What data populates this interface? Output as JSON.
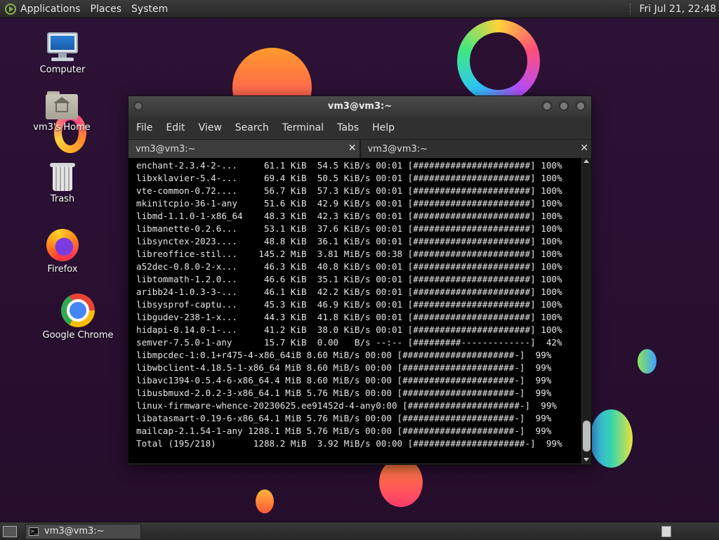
{
  "top_panel": {
    "menus": [
      "Applications",
      "Places",
      "System"
    ],
    "clock": "Fri Jul 21, 22:48"
  },
  "desktop_icons": [
    {
      "label": "Computer",
      "icon": "computer-icon"
    },
    {
      "label": "vm3's Home",
      "icon": "home-folder-icon"
    },
    {
      "label": "Trash",
      "icon": "trash-icon"
    },
    {
      "label": "Firefox",
      "icon": "firefox-icon"
    },
    {
      "label": "Google Chrome",
      "icon": "chrome-icon"
    }
  ],
  "window": {
    "title": "vm3@vm3:~",
    "menu": [
      "File",
      "Edit",
      "View",
      "Search",
      "Terminal",
      "Tabs",
      "Help"
    ],
    "tabs": [
      {
        "label": "vm3@vm3:~",
        "active": true
      },
      {
        "label": "vm3@vm3:~",
        "active": false
      }
    ],
    "terminal_lines": [
      "enchant-2.3.4-2-...     61.1 KiB  54.5 KiB/s 00:01 [######################] 100%",
      "libxklavier-5.4-...     69.4 KiB  50.5 KiB/s 00:01 [######################] 100%",
      "vte-common-0.72....     56.7 KiB  57.3 KiB/s 00:01 [######################] 100%",
      "mkinitcpio-36-1-any     51.6 KiB  42.9 KiB/s 00:01 [######################] 100%",
      "libmd-1.1.0-1-x86_64    48.3 KiB  42.3 KiB/s 00:01 [######################] 100%",
      "libmanette-0.2.6...     53.1 KiB  37.6 KiB/s 00:01 [######################] 100%",
      "libsynctex-2023....     48.8 KiB  36.1 KiB/s 00:01 [######################] 100%",
      "libreoffice-stil...    145.2 MiB  3.81 MiB/s 00:38 [######################] 100%",
      "a52dec-0.8.0-2-x...     46.3 KiB  40.8 KiB/s 00:01 [######################] 100%",
      "libtommath-1.2.0...     46.6 KiB  35.1 KiB/s 00:01 [######################] 100%",
      "aribb24-1.0.3-3-...     46.1 KiB  42.2 KiB/s 00:01 [######################] 100%",
      "libsysprof-captu...     45.3 KiB  46.9 KiB/s 00:01 [######################] 100%",
      "libgudev-238-1-x...     44.3 KiB  41.8 KiB/s 00:01 [######################] 100%",
      "hidapi-0.14.0-1-...     41.2 KiB  38.0 KiB/s 00:01 [######################] 100%",
      "semver-7.5.0-1-any      15.7 KiB  0.00   B/s --:-- [#########-------------]  42%",
      "libmpcdec-1:0.1+r475-4-x86_64iB 8.60 MiB/s 00:00 [#####################-]  99%",
      "libwbclient-4.18.5-1-x86_64 MiB 8.60 MiB/s 00:00 [#####################-]  99%",
      "libavc1394-0.5.4-6-x86_64.4 MiB 8.60 MiB/s 00:00 [#####################-]  99%",
      "libusbmuxd-2.0.2-3-x86_64.1 MiB 5.76 MiB/s 00:00 [#####################-]  99%",
      "linux-firmware-whence-20230625.ee91452d-4-any0:00 [#####################-]  99%",
      "libatasmart-0.19-6-x86_64.1 MiB 5.76 MiB/s 00:00 [#####################-]  99%",
      "mailcap-2.1.54-1-any 1288.1 MiB 5.76 MiB/s 00:00 [#####################-]  99%",
      "Total (195/218)       1288.2 MiB  3.92 MiB/s 00:00 [#####################-]  99%"
    ]
  },
  "taskbar": {
    "tasks": [
      {
        "label": "vm3@vm3:~",
        "icon": "terminal-icon"
      }
    ]
  }
}
